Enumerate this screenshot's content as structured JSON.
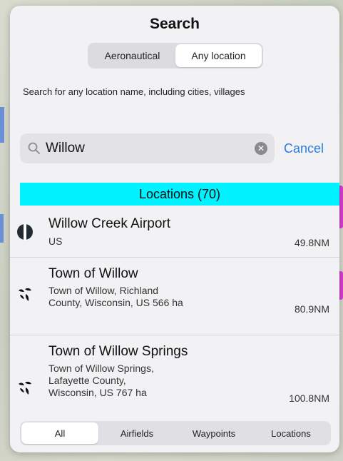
{
  "title": "Search",
  "mode_tabs": [
    "Aeronautical",
    "Any location"
  ],
  "hint": "Search for any location name, including cities, villages",
  "search": {
    "value": "Willow",
    "cancel_label": "Cancel"
  },
  "section_header": "Locations (70)",
  "results": [
    {
      "name": "Willow Creek Airport",
      "sub": "US",
      "distance": "49.8NM",
      "icon": "airport-icon"
    },
    {
      "name": "Town of Willow",
      "sub": "Town of Willow, Richland County, Wisconsin, US 566 ha",
      "distance": "80.9NM",
      "icon": "town-icon"
    },
    {
      "name": "Town of Willow Springs",
      "sub": "Town of Willow Springs, Lafayette County, Wisconsin, US 767 ha",
      "distance": "100.8NM",
      "icon": "town-icon"
    }
  ],
  "filter_tabs": [
    "All",
    "Airfields",
    "Waypoints",
    "Locations"
  ],
  "colors": {
    "accent": "#2a7de1",
    "section": "#00f2ff"
  }
}
